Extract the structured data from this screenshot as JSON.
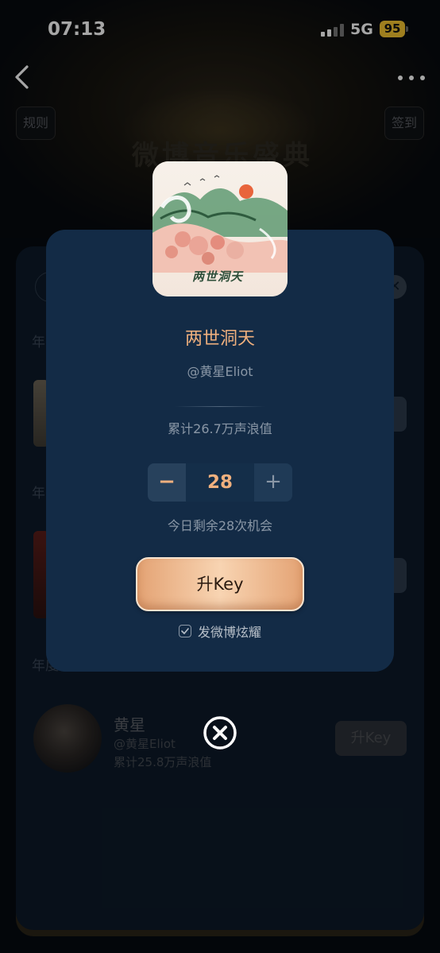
{
  "status_bar": {
    "time": "07:13",
    "network": "5G",
    "battery": "95"
  },
  "background": {
    "left_pill": "规则",
    "right_pill": "签到",
    "logo_text": "微博音乐盛典",
    "section_labels": [
      "年",
      "年",
      "年度"
    ],
    "row": {
      "name": "黄星",
      "handle": "@黄星Eliot",
      "total": "累计25.8万声浪值",
      "button": "升Key"
    }
  },
  "modal": {
    "cover_caption": "两世洞天",
    "title": "两世洞天",
    "artist": "@黄星Eliot",
    "total": "累计26.7万声浪值",
    "stepper": {
      "minus": "−",
      "value": "28",
      "plus": "+"
    },
    "remaining": "今日剩余28次机会",
    "boost_label": "升Key",
    "share_label": "发微博炫耀",
    "share_checked": true
  },
  "colors": {
    "accent": "#f0b07e",
    "panel": "#132b46",
    "muted": "#8a97a6"
  }
}
